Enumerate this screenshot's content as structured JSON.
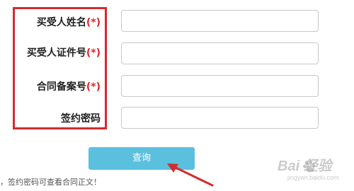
{
  "form": {
    "fields": [
      {
        "label": "买受人姓名",
        "required_mark": "(*)"
      },
      {
        "label": "买受人证件号",
        "required_mark": "(*)"
      },
      {
        "label": "合同备案号",
        "required_mark": "(*)"
      },
      {
        "label": "签约密码",
        "required_mark": ""
      }
    ],
    "submit_label": "查询",
    "hint": "，签约密码可查看合同正文！"
  },
  "watermark": {
    "brand": "Bai  经验",
    "url": "jingyan.baidu.com"
  },
  "colors": {
    "highlight": "#d52b2b",
    "button": "#5bc0de",
    "required": "#d52b2b"
  }
}
